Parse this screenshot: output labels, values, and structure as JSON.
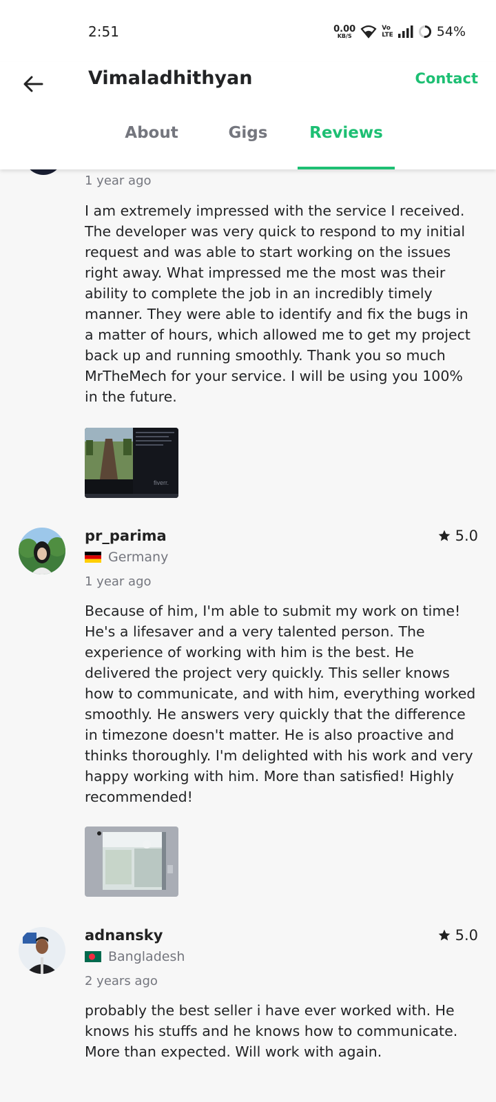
{
  "status_bar": {
    "time": "2:51",
    "network_speed_value": "0.00",
    "network_speed_unit": "KB/S",
    "volte_top": "Vo",
    "volte_bottom": "LTE",
    "battery_percent": "54%"
  },
  "header": {
    "title": "Vimaladhithyan",
    "contact_label": "Contact",
    "tabs": [
      {
        "label": "About"
      },
      {
        "label": "Gigs"
      },
      {
        "label": "Reviews",
        "active": true
      }
    ]
  },
  "reviews": [
    {
      "time_ago": "1 year ago",
      "text": "I am extremely impressed with the service I received. The developer was very quick to respond to my initial request and was able to start working on the issues right away. What impressed me the most was their ability to complete the job in an incredibly timely manner. They were able to identify and fix the bugs in a matter of hours, which allowed me to get my project back up and running smoothly. Thank you so much MrTheMech for your service. I will be using you 100% in the future.",
      "attachment_watermark": "fiverr."
    },
    {
      "username": "pr_parima",
      "rating": "5.0",
      "country": "Germany",
      "time_ago": "1 year ago",
      "text": "Because of him, I'm able to submit my work on time! He's a lifesaver and a very talented person. The experience of working with him is the best. He delivered the project very quickly. This seller knows how to communicate, and with him, everything worked smoothly. He answers very quickly that the difference in timezone doesn't matter. He is also proactive and thinks thoroughly. I'm delighted with his work and very happy working with him. More than satisfied! Highly recommended!"
    },
    {
      "username": "adnansky",
      "rating": "5.0",
      "country": "Bangladesh",
      "time_ago": "2 years ago",
      "text": "probably the best seller i have ever worked with. He knows his stuffs and he knows how to communicate. More than expected. Will work with again."
    }
  ],
  "colors": {
    "accent": "#1dbf73",
    "text_primary": "#222325",
    "text_secondary": "#74767e",
    "background": "#f7f7f7"
  }
}
